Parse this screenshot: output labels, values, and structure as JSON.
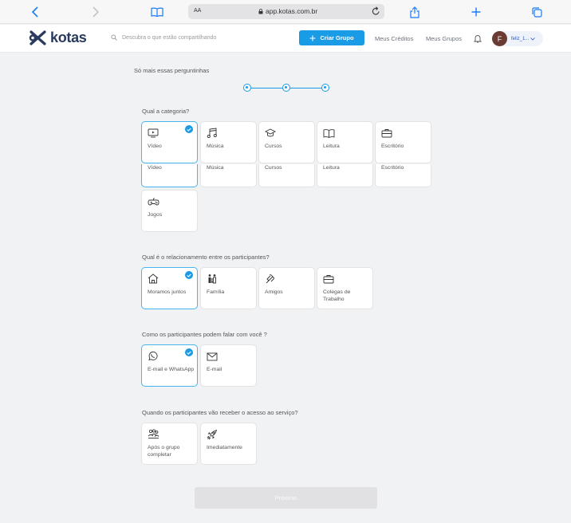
{
  "browser": {
    "reader_label": "AA",
    "url": "app.kotas.com.br"
  },
  "header": {
    "brand": "kotas",
    "search_placeholder": "Descubra o que estão compartilhando",
    "create_group": "Criar Grupo",
    "credits": "Meus Créditos",
    "groups": "Meus Grupos",
    "user_initial": "F",
    "user_name": "feliz_1..."
  },
  "intro": "Só mais essas perguntinhas",
  "questions": {
    "category": {
      "label": "Qual a categoria?",
      "options": [
        "Vídeo",
        "Música",
        "Cursos",
        "Leitura",
        "Escritório"
      ],
      "options_repeat": [
        "Vídeo",
        "Música",
        "Cursos",
        "Leitura",
        "Escritório"
      ],
      "extra": "Jogos"
    },
    "relationship": {
      "label": "Qual é o relacionamento entre os participantes?",
      "options": [
        "Moramos juntos",
        "Família",
        "Amigos",
        "Colegas de Trabalho"
      ]
    },
    "contact": {
      "label": "Como os participantes podem falar com você ?",
      "options": [
        "E-mail e WhatsApp",
        "E-mail"
      ]
    },
    "access": {
      "label": "Quando os participantes vão receber o acesso ao serviço?",
      "options": [
        "Após o grupo completar",
        "Imediatamente"
      ]
    }
  },
  "next_label": "Próximo",
  "colors": {
    "accent": "#1a9be6",
    "brand": "#2a3a5e"
  }
}
